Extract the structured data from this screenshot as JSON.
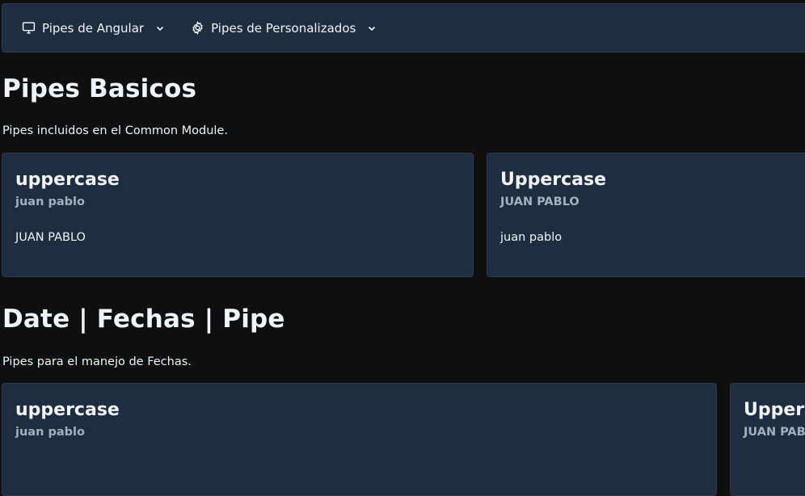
{
  "menubar": {
    "items": [
      {
        "label": "Pipes de Angular",
        "icon": "desktop-icon"
      },
      {
        "label": "Pipes de Personalizados",
        "icon": "gear-icon"
      }
    ]
  },
  "sections": [
    {
      "title": "Pipes Basicos",
      "subtitle": "Pipes incluidos en el Common Module.",
      "cards": [
        {
          "title": "uppercase",
          "subtitle": "juan pablo",
          "content": "JUAN PABLO"
        },
        {
          "title": "Uppercase",
          "subtitle": "JUAN PABLO",
          "content": "juan pablo"
        }
      ]
    },
    {
      "title": "Date | Fechas | Pipe",
      "subtitle": "Pipes para el manejo de Fechas.",
      "cards": [
        {
          "title": "uppercase",
          "subtitle": "juan pablo"
        },
        {
          "title": "Upperc",
          "subtitle": "JUAN PAB"
        }
      ]
    }
  ],
  "colors": {
    "background": "#0f0f10",
    "surface": "#1f2d40",
    "text": "#f0f3f7",
    "muted": "#a5b0bf"
  }
}
